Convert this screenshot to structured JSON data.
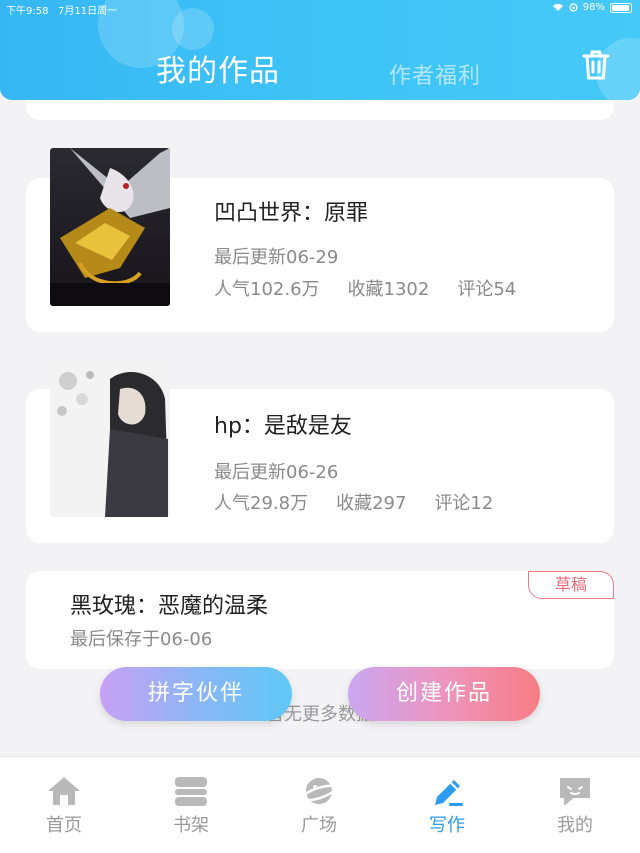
{
  "status_bar": {
    "time": "下午9:58",
    "date": "7月11日周一",
    "battery": "98%"
  },
  "header": {
    "tab_active": "我的作品",
    "tab_inactive": "作者福利",
    "trash_icon": "trash-icon"
  },
  "works": [
    {
      "title": "凹凸世界：原罪",
      "updated": "最后更新06-29",
      "popularity": "人气102.6万",
      "favorites": "收藏1302",
      "comments": "评论54"
    },
    {
      "title": "hp：是敌是友",
      "updated": "最后更新06-26",
      "popularity": "人气29.8万",
      "favorites": "收藏297",
      "comments": "评论12"
    }
  ],
  "draft": {
    "title": "黑玫瑰：恶魔的温柔",
    "saved": "最后保存于06-06",
    "badge": "草稿"
  },
  "no_more": "暂无更多数据",
  "buttons": {
    "partner": "拼字伙伴",
    "create": "创建作品"
  },
  "nav": [
    {
      "label": "首页",
      "icon": "home-icon"
    },
    {
      "label": "书架",
      "icon": "bookshelf-icon"
    },
    {
      "label": "广场",
      "icon": "planet-icon"
    },
    {
      "label": "写作",
      "icon": "pen-icon"
    },
    {
      "label": "我的",
      "icon": "chat-bubble-icon"
    }
  ],
  "colors": {
    "header": "#3ec3f6",
    "active_tab": "#2d9bf0",
    "draft_badge": "#ef6c7c"
  }
}
